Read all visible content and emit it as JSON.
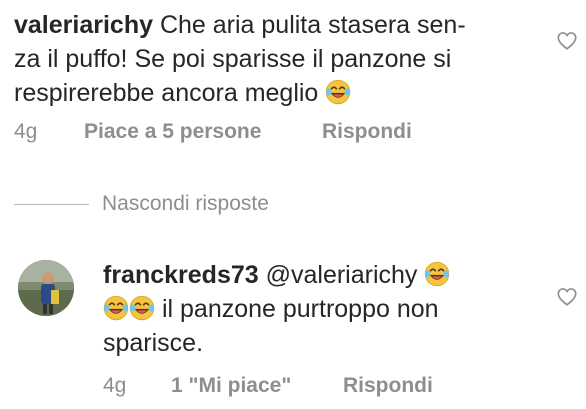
{
  "top_comment": {
    "username": "valeriarichy",
    "text_line1": "Che aria pulita stasera sen-",
    "text_line2": "za il puffo! Se poi sparisse il panzone si",
    "text_line3": "respirerebbe ancora meglio",
    "emoji": "face-with-tears-of-joy",
    "time": "4g",
    "likes": "Piace a 5 persone",
    "reply_label": "Rispondi"
  },
  "replies_toggle": {
    "label": "Nascondi risposte"
  },
  "reply_comment": {
    "username": "franckreds73",
    "mention": "@valeriarichy",
    "text_line2": "il panzone purtroppo non",
    "text_line3": "sparisce.",
    "emoji": "face-with-tears-of-joy",
    "time": "4g",
    "likes": "1 \"Mi piace\"",
    "reply_label": "Rispondi"
  },
  "colors": {
    "text": "#262626",
    "secondary": "#8e8e8e",
    "emoji_face": "#f5c542"
  }
}
